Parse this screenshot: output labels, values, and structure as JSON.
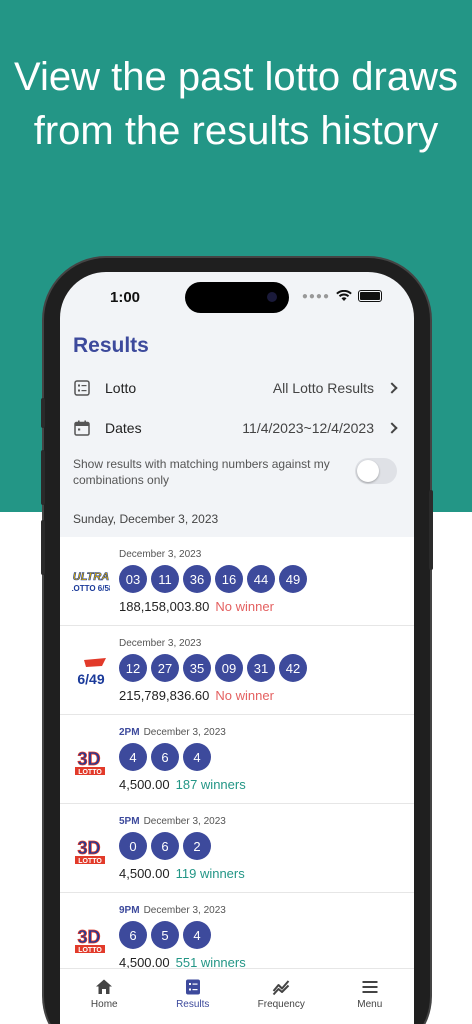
{
  "headline": "View the past lotto draws from the results history",
  "status": {
    "time": "1:00"
  },
  "page_title": "Results",
  "filters": {
    "lotto_label": "Lotto",
    "lotto_value": "All Lotto Results",
    "dates_label": "Dates",
    "dates_value": "11/4/2023~12/4/2023",
    "toggle_text": "Show results with matching numbers against my combinations only"
  },
  "date_header": "Sunday, December 3, 2023",
  "results": [
    {
      "logo": "ultra-lotto-6-58-logo",
      "draw_time": "",
      "date": "December 3, 2023",
      "numbers": [
        "03",
        "11",
        "36",
        "16",
        "44",
        "49"
      ],
      "prize": "188,158,003.80",
      "status": "No winner"
    },
    {
      "logo": "grand-lotto-6-49-logo",
      "draw_time": "",
      "date": "December 3, 2023",
      "numbers": [
        "12",
        "27",
        "35",
        "09",
        "31",
        "42"
      ],
      "prize": "215,789,836.60",
      "status": "No winner"
    },
    {
      "logo": "3d-lotto-logo",
      "draw_time": "2PM",
      "date": "December 3, 2023",
      "numbers": [
        "4",
        "6",
        "4"
      ],
      "prize": "4,500.00",
      "status": "187 winners"
    },
    {
      "logo": "3d-lotto-logo",
      "draw_time": "5PM",
      "date": "December 3, 2023",
      "numbers": [
        "0",
        "6",
        "2"
      ],
      "prize": "4,500.00",
      "status": "119 winners"
    },
    {
      "logo": "3d-lotto-logo",
      "draw_time": "9PM",
      "date": "December 3, 2023",
      "numbers": [
        "6",
        "5",
        "4"
      ],
      "prize": "4,500.00",
      "status": "551 winners"
    }
  ],
  "tabs": [
    {
      "label": "Home",
      "icon": "home-icon"
    },
    {
      "label": "Results",
      "icon": "results-icon"
    },
    {
      "label": "Frequency",
      "icon": "frequency-icon"
    },
    {
      "label": "Menu",
      "icon": "menu-icon"
    }
  ],
  "colors": {
    "brand": "#239686",
    "accent": "#3d4a9c",
    "no_winner": "#e46060"
  }
}
